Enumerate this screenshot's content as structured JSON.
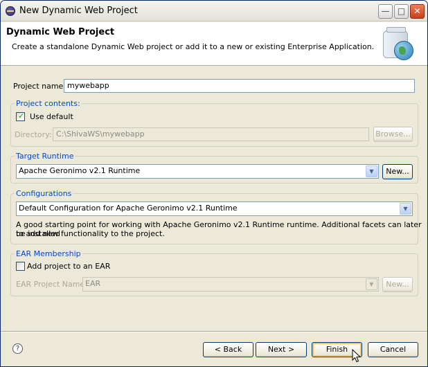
{
  "window": {
    "title": "New Dynamic Web Project",
    "minimize": "—",
    "maximize": "□",
    "close": "✕"
  },
  "header": {
    "title": "Dynamic Web Project",
    "description": "Create a standalone Dynamic Web project or add it to a new or existing Enterprise Application."
  },
  "project_name": {
    "label": "Project name:",
    "value": "mywebapp"
  },
  "project_contents": {
    "legend": "Project contents:",
    "use_default_label": "Use default",
    "use_default_checked": true,
    "checkmark": "✓",
    "directory_label": "Directory:",
    "directory_value": "C:\\ShivaWS\\mywebapp",
    "browse_label": "Browse..."
  },
  "target_runtime": {
    "legend": "Target Runtime",
    "selected": "Apache Geronimo v2.1 Runtime",
    "new_label": "New..."
  },
  "configurations": {
    "legend": "Configurations",
    "selected": "Default Configuration for Apache Geronimo v2.1 Runtime",
    "description_line1": "A good starting point for working with Apache Geronimo v2.1 Runtime runtime. Additional facets can later be installed",
    "description_line2": "to add new functionality to the project."
  },
  "ear_membership": {
    "legend": "EAR Membership",
    "add_label": "Add project to an EAR",
    "add_checked": false,
    "ear_name_label": "EAR Project Name:",
    "ear_name_value": "EAR",
    "new_label": "New..."
  },
  "footer": {
    "help": "?",
    "back_label": "< Back",
    "next_label": "Next >",
    "finish_label": "Finish",
    "cancel_label": "Cancel"
  },
  "icons": {
    "combo_arrow": "▼",
    "cursor": "arrow-pointer"
  }
}
